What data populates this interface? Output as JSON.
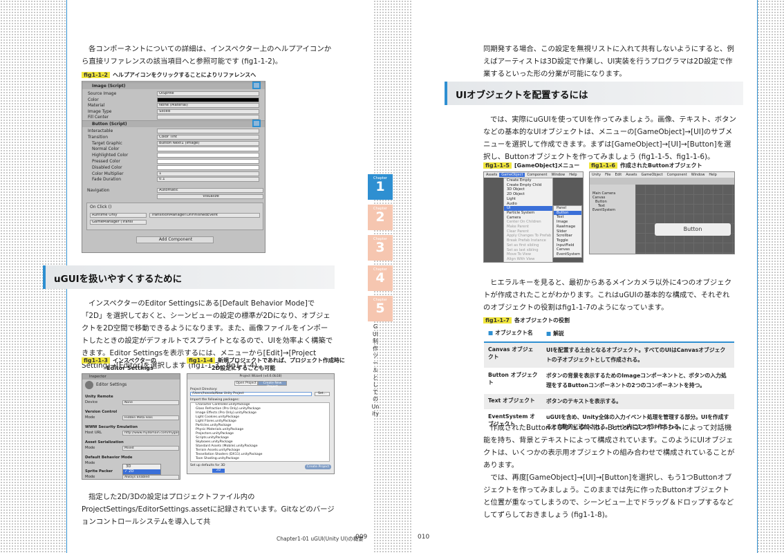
{
  "left_page": {
    "intro": "各コンポーネントについての詳細は、インスペクター上のヘルプアイコンから直接リファレンスの該当項目へと参照可能です (fig1-1-2)。",
    "fig2": {
      "tag": "fig1-1-2",
      "caption": "ヘルプアイコンをクリックすることによりリファレンスへ"
    },
    "inspector": {
      "image_title": "Image (Script)",
      "image_rows": [
        {
          "label": "Source Image",
          "value": "UISprite"
        },
        {
          "label": "Color",
          "value": ""
        },
        {
          "label": "Material",
          "value": "None (Material)"
        },
        {
          "label": "Image Type",
          "value": "Sliced"
        },
        {
          "label": "Fill Center",
          "value": ""
        }
      ],
      "button_title": "Button (Script)",
      "button_rows": [
        {
          "label": "Interactable",
          "value": ""
        },
        {
          "label": "Transition",
          "value": "Color Tint"
        },
        {
          "label": "Target Graphic",
          "value": "Button Next1 (Image)"
        },
        {
          "label": "Normal Color",
          "value": ""
        },
        {
          "label": "Highlighted Color",
          "value": ""
        },
        {
          "label": "Pressed Color",
          "value": ""
        },
        {
          "label": "Disabled Color",
          "value": ""
        },
        {
          "label": "Color Multiplier",
          "value": "1"
        },
        {
          "label": "Fade Duration",
          "value": "0.1"
        }
      ],
      "navigation_label": "Navigation",
      "navigation_value": "Automatic",
      "visualize": "Visualize",
      "onclick": "On Click ()",
      "runtime": "Runtime Only",
      "function": "TransitionManager.OnFinishedEvent",
      "object": "GameManager (Transi",
      "add_component": "Add Component"
    },
    "heading": "uGUIを扱いやすくするために",
    "para": "インスペクターのEditor Settingsにある[Default Behavior Mode]で「2D」を選択しておくと、シーンビューの設定の標準が2Dになり、オブジェクトを2D空間で移動できるようになります。また、画像ファイルをインポートしたときの設定がデフォルトでスプライトとなるので、UIを効率よく構築できます。Editor Settingsを表示するには、メニューから[Edit]→[Project Setting]→[Editor]を選択します (fig1-1-3、fig1-1-4)。",
    "fig3": {
      "tag": "fig1-1-3",
      "caption_line1": "インスペクターの",
      "caption_line2": "Editor Settings"
    },
    "fig4": {
      "tag": "fig1-1-4",
      "caption_line1": "新規プロジェクトであれば、プロジェクト作成時に",
      "caption_line2": "2D設定にすることも可能"
    },
    "editor_settings": {
      "tab": "Inspector",
      "title": "Editor Settings",
      "unity_remote": "Unity Remote",
      "device": "Device",
      "device_value": "None",
      "version_control": "Version Control",
      "mode": "Mode",
      "mode_value": "Hidden Meta Files",
      "www": "WWW Security Emulation",
      "host_url": "Host URL",
      "host_value": "http://www.mydomain.com/mygam",
      "asset_serialization": "Asset Serialization",
      "asset_mode": "Mixed",
      "default_behavior": "Default Behavior Mode",
      "dbm_options": [
        "3D",
        "✓ 2D"
      ],
      "sprite_packer": "Sprite Packer",
      "sprite_mode": "Always Enabled"
    },
    "new_project": {
      "title": "Project Wizard (v4.6.0b18)",
      "open_tab": "Open Project",
      "create_tab": "Create New Project",
      "dir_label": "Project Directory:",
      "dir_value": "/Users/hosoda/New Unity Project",
      "set_btn": "Set...",
      "import_label": "Import the following packages:",
      "packages": [
        "Character Controller.unityPackage",
        "Glass Refraction (Pro Only).unityPackage",
        "Image Effects (Pro Only).unityPackage",
        "Light Cookies.unityPackage",
        "Light Flares.unityPackage",
        "Particles.unityPackage",
        "Physic Materials.unityPackage",
        "Projectors.unityPackage",
        "Scripts.unityPackage",
        "Skyboxes.unityPackage",
        "Standard Assets (Mobile).unityPackage",
        "Terrain Assets.unityPackage",
        "Tessellation Shaders (DX11).unityPackage",
        "Toon Shading.unityPackage"
      ],
      "setup_label": "Set up defaults for",
      "setup_options": [
        "3D",
        "2D"
      ],
      "create_btn": "Create Project"
    },
    "bottom": "指定した2D/3Dの設定はプロジェクトファイル内のProjectSettings/EditorSettings.assetに記録されています。Gitなどのバージョンコントロールシステムを導入して共",
    "footer_chapter": "Chapter1-01  uGUI(Unity UI)の概要",
    "page_number": "009"
  },
  "right_page": {
    "intro": "同期発する場合、この設定を無視リストに入れて共有しないようにすると、例えばアーティストは3D設定で作業し、UI実装を行うプログラマは2D設定で作業するといった形の分業が可能になります。",
    "heading": "UIオブジェクトを配置するには",
    "para1": "では、実際にuGUIを使ってUIを作ってみましょう。画像、テキスト、ボタンなどの基本的なUIオブジェクトは、メニューの[GameObject]→[UI]のサブメニューを選択して作成できます。まずは[GameObject]→[UI]→[Button]を選択し、Buttonオブジェクトを作ってみましょう (fig1-1-5、fig1-1-6)。",
    "fig5": {
      "tag": "fig1-1-5",
      "caption": "[GameObject]メニュー"
    },
    "fig6": {
      "tag": "fig1-1-6",
      "caption": "作成されたButtonオブジェクト"
    },
    "menubar": [
      "Assets",
      "GameObject",
      "Component",
      "Window",
      "Help"
    ],
    "gameobject_menu": [
      "Create Empty",
      "Create Empty Child",
      "3D Object",
      "2D Object",
      "Light",
      "Audio",
      "UI",
      "Particle System",
      "Camera",
      "Center On Children",
      "Make Parent",
      "Clear Parent",
      "Apply Changes To Prefab",
      "Break Prefab Instance",
      "Set as first sibling",
      "Set as last sibling",
      "Move To View",
      "Align With View"
    ],
    "ui_submenu": [
      "Panel",
      "Button",
      "Text",
      "Image",
      "RawImage",
      "Slider",
      "Scrollbar",
      "Toggle",
      "InputField",
      "Canvas",
      "EventSystem"
    ],
    "unity_menubar": [
      "Unity",
      "File",
      "Edit",
      "Assets",
      "GameObject",
      "Component",
      "Window",
      "Help"
    ],
    "hierarchy": [
      "Main Camera",
      "Canvas",
      "Button",
      "Text",
      "EventSystem"
    ],
    "button_label": "Button",
    "para2": "ヒエラルキーを見ると、最初からあるメインカメラ以外に4つのオブジェクトが作成されたことがわかります。これはuGUIの基本的な構成で、それぞれのオブジェクトの役割はfig1-1-7のようになっています。",
    "fig7": {
      "tag": "fig1-1-7",
      "caption": "各オブジェクトの役割"
    },
    "table_head": [
      "オブジェクト名",
      "解説"
    ],
    "table_rows": [
      {
        "name": "Canvas オブジェクト",
        "desc": "UIを配置する土台となるオブジェクト。すべてのUIはCanvasオブジェクトの子オブジェクトとして作成される。"
      },
      {
        "name": "Button オブジェクト",
        "desc": "ボタンの背景を表示するためのImageコンポーネントと、ボタンの入力処理をするButtonコンポーネントの2つのコンポーネントを持つ。"
      },
      {
        "name": "Text オブジェクト",
        "desc": "ボタンのテキストを表示する。"
      },
      {
        "name": "EventSystem オブジェクト",
        "desc": "uGUIを含め、Unity全体の入力イベント処理を管理する部分。UIを作成すると自動的に追加される。シーン内に1つだけ作られる。"
      }
    ],
    "para3": "作成されたButtonオブジェクトは、Buttonコンポーネントによって対話機能を持ち、背景とテキストによって構成されています。このようにUIオブジェクトは、いくつかの表示用オブジェクトの組み合わせで構成されていることがあります。\n　では、再度[GameObject]→[UI]→[Button]を選択し、もう1つButtonオブジェクトを作ってみましょう。このままでは先に作ったButtonオブジェクトと位置が重なってしまうので、シーンビュー上でドラッグ＆ドロップするなどしてずらしておきましょう (fig1-1-8)。",
    "page_number": "010"
  },
  "chapter_tabs": [
    {
      "label": "Chapter",
      "number": "1"
    },
    {
      "label": "Chapter",
      "number": "2"
    },
    {
      "label": "Chapter",
      "number": "3"
    },
    {
      "label": "Chapter",
      "number": "4"
    },
    {
      "label": "Chapter",
      "number": "5"
    }
  ],
  "vertical_title": "GUI制作ツールとしてのUnity",
  "colors": {
    "accent": "#2e8fd1",
    "tag": "#f1e63c",
    "tab_active": "#2e8fd1",
    "tab_inactive": "#f6c6b0"
  }
}
